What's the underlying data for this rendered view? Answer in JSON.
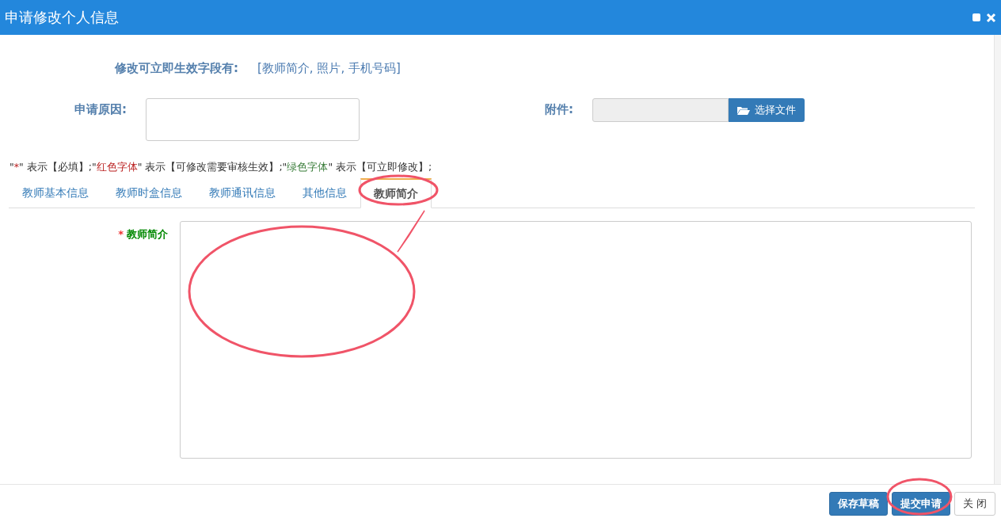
{
  "window": {
    "title": "申请修改个人信息"
  },
  "instant_fields": {
    "label": "修改可立即生效字段有:",
    "value": "[教师简介, 照片, 手机号码]"
  },
  "reason": {
    "label": "申请原因:"
  },
  "attachment": {
    "label": "附件:",
    "button": "选择文件"
  },
  "legend": [
    {
      "kind": "plain",
      "text": "\""
    },
    {
      "kind": "red",
      "text": "*"
    },
    {
      "kind": "plain",
      "text": "\" 表示【必填】;\""
    },
    {
      "kind": "red",
      "text": "红色字体"
    },
    {
      "kind": "plain",
      "text": "\" 表示【可修改需要审核生效】;\""
    },
    {
      "kind": "green",
      "text": "绿色字体"
    },
    {
      "kind": "plain",
      "text": "\" 表示【可立即修改】;"
    }
  ],
  "tabs": [
    {
      "label": "教师基本信息",
      "selected": false
    },
    {
      "label": "教师时盒信息",
      "selected": false
    },
    {
      "label": "教师通讯信息",
      "selected": false
    },
    {
      "label": "其他信息",
      "selected": false
    },
    {
      "label": "教师简介",
      "selected": true
    }
  ],
  "field": {
    "required_mark": "*",
    "label": "教师简介"
  },
  "buttons": [
    {
      "label": "保存草稿",
      "kind": "primary"
    },
    {
      "label": "提交申请",
      "kind": "primary"
    },
    {
      "label": "关 闭",
      "kind": "default"
    }
  ]
}
